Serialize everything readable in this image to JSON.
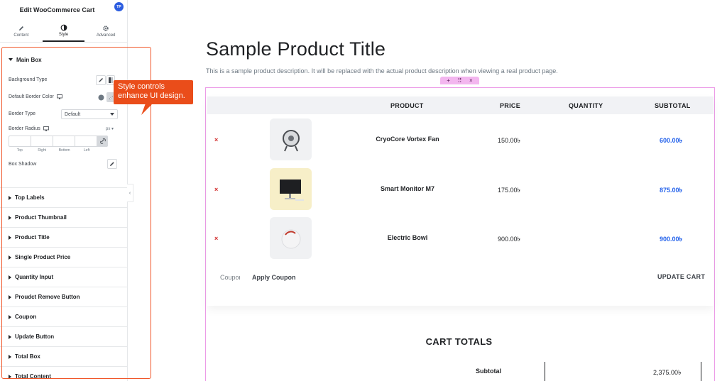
{
  "panel": {
    "title": "Edit WooCommerce Cart",
    "avatar": "TP",
    "tabs": [
      {
        "label": "Content",
        "icon": "pencil-icon"
      },
      {
        "label": "Style",
        "icon": "half-circle-icon"
      },
      {
        "label": "Advanced",
        "icon": "gear-icon"
      }
    ],
    "active_tab": "Style",
    "main_box": {
      "label": "Main Box",
      "background_type": "Background Type",
      "default_border_color": "Default Border Color",
      "border_type": "Border Type",
      "border_type_value": "Default",
      "border_radius": "Border Radius",
      "unit": "px",
      "dims": [
        "Top",
        "Right",
        "Bottom",
        "Left"
      ],
      "box_shadow": "Box Shadow"
    },
    "sections": [
      "Top Labels",
      "Product Thumbnail",
      "Product Title",
      "Single Product Price",
      "Quantity Input",
      "Proudct Remove Button",
      "Coupon",
      "Update Button",
      "Total Box",
      "Total Content"
    ]
  },
  "callout": {
    "line1": "Style controls",
    "line2": "enhance UI design."
  },
  "page": {
    "title": "Sample Product Title",
    "description": "This is a sample product description. It will be replaced with the actual product description when viewing a real product page."
  },
  "edit_handle": {
    "add": "+",
    "move": "⠿",
    "close": "×"
  },
  "cart": {
    "headers": {
      "product": "PRODUCT",
      "price": "PRICE",
      "quantity": "QUANTITY",
      "subtotal": "SUBTOTAL"
    },
    "items": [
      {
        "name": "CryoCore Vortex Fan",
        "price": "150.00৳",
        "subtotal": "600.00৳",
        "thumb": "fan"
      },
      {
        "name": "Smart Monitor M7",
        "price": "175.00৳",
        "subtotal": "875.00৳",
        "thumb": "monitor"
      },
      {
        "name": "Electric Bowl",
        "price": "900.00৳",
        "subtotal": "900.00৳",
        "thumb": "bowl"
      }
    ],
    "remove_symbol": "×",
    "coupon_placeholder": "Coupon code",
    "apply_coupon": "Apply Coupon",
    "update_cart": "UPDATE CART"
  },
  "totals": {
    "title": "CART TOTALS",
    "subtotal_label": "Subtotal",
    "subtotal_value": "2,375.00৳"
  },
  "colors": {
    "accent_orange": "#ea4d1a",
    "subtotal_blue": "#2563eb",
    "remove_red": "#d22a2a",
    "frame_pink": "#ec9be7"
  }
}
